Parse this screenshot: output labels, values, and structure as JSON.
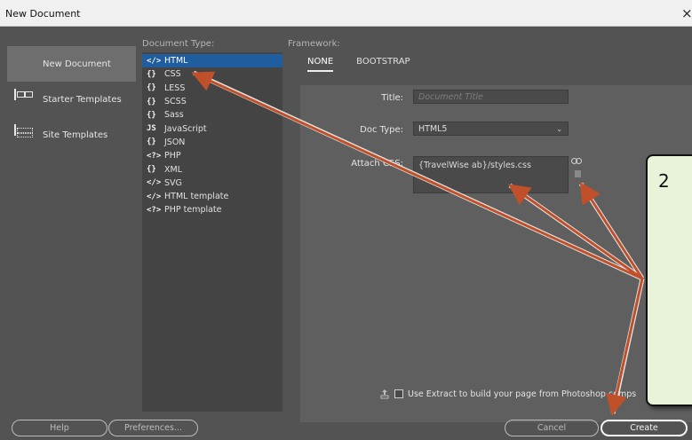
{
  "window": {
    "title": "New Document",
    "close_glyph": "×"
  },
  "left_nav": {
    "items": [
      {
        "label": "New Document",
        "icon": "document-icon",
        "active": true
      },
      {
        "label": "Starter Templates",
        "icon": "starter-templates-icon",
        "active": false
      },
      {
        "label": "Site Templates",
        "icon": "site-templates-icon",
        "active": false
      }
    ]
  },
  "document_type": {
    "heading": "Document Type:",
    "items": [
      {
        "icon": "</>",
        "label": "HTML",
        "selected": true
      },
      {
        "icon": "{}",
        "label": "CSS"
      },
      {
        "icon": "{}",
        "label": "LESS"
      },
      {
        "icon": "{}",
        "label": "SCSS"
      },
      {
        "icon": "{}",
        "label": "Sass"
      },
      {
        "icon": "JS",
        "label": "JavaScript"
      },
      {
        "icon": "{}",
        "label": "JSON"
      },
      {
        "icon": "<?>",
        "label": "PHP"
      },
      {
        "icon": "{}",
        "label": "XML"
      },
      {
        "icon": "</>",
        "label": "SVG"
      },
      {
        "icon": "</>",
        "label": "HTML template"
      },
      {
        "icon": "<?>",
        "label": "PHP template"
      }
    ]
  },
  "framework": {
    "heading": "Framework:",
    "tabs": [
      {
        "label": "NONE",
        "active": true
      },
      {
        "label": "BOOTSTRAP",
        "active": false
      }
    ],
    "title_label": "Title:",
    "title_placeholder": "Document Title",
    "doctype_label": "Doc Type:",
    "doctype_value": "HTML5",
    "attach_css_label": "Attach CSS:",
    "attach_css_value": "{TravelWise ab}/styles.css",
    "extract_label": "Use Extract to build your page from Photoshop comps"
  },
  "buttons": {
    "help": "Help",
    "preferences": "Preferences...",
    "cancel": "Cancel",
    "create": "Create"
  },
  "callout": {
    "number": "2"
  },
  "colors": {
    "dialog_bg": "#535353",
    "selection": "#1f5d9e",
    "arrow": "#c0502a",
    "callout_bg": "#e9f3da"
  }
}
